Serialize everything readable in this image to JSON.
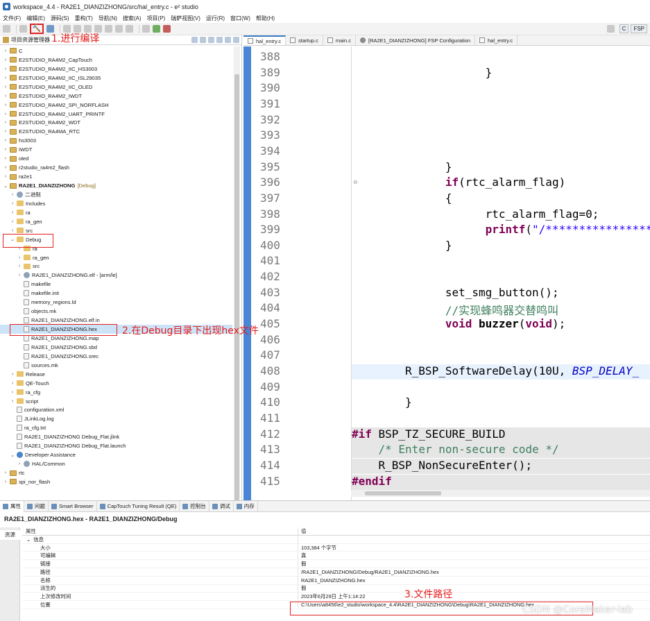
{
  "window": {
    "title": "workspace_4.4 - RA2E1_DIANZIZHONG/src/hal_entry.c - e² studio"
  },
  "menu": [
    "文件(F)",
    "编辑(E)",
    "源码(S)",
    "重构(T)",
    "导航(N)",
    "搜索(A)",
    "项目(P)",
    "瑞萨视图(V)",
    "运行(R)",
    "窗口(W)",
    "帮助(H)"
  ],
  "toolbar": {
    "perspective_c": "C",
    "perspective_fsp": "FSP"
  },
  "annotations": {
    "build": "1.进行编译",
    "hex": "2.在Debug目录下出现hex文件",
    "path": "3.文件路径"
  },
  "explorer": {
    "title": "项目资源管理器",
    "items": [
      {
        "label": "C",
        "depth": 0,
        "chev": "›",
        "icon": "project"
      },
      {
        "label": "E2STUDIO_RA4M2_CapTouch",
        "depth": 0,
        "chev": "›",
        "icon": "project"
      },
      {
        "label": "E2STUDIO_RA4M2_IIC_HS3003",
        "depth": 0,
        "chev": "›",
        "icon": "project"
      },
      {
        "label": "E2STUDIO_RA4M2_IIC_ISL29035",
        "depth": 0,
        "chev": "›",
        "icon": "project"
      },
      {
        "label": "E2STUDIO_RA4M2_IIC_OLED",
        "depth": 0,
        "chev": "›",
        "icon": "project"
      },
      {
        "label": "E2STUDIO_RA4M2_IWDT",
        "depth": 0,
        "chev": "›",
        "icon": "project"
      },
      {
        "label": "E2STUDIO_RA4M2_SPI_NORFLASH",
        "depth": 0,
        "chev": "›",
        "icon": "project"
      },
      {
        "label": "E2STUDIO_RA4M2_UART_PRINTF",
        "depth": 0,
        "chev": "›",
        "icon": "project"
      },
      {
        "label": "E2STUDIO_RA4M2_WDT",
        "depth": 0,
        "chev": "›",
        "icon": "project"
      },
      {
        "label": "E2STUDIO_RA4MA_RTC",
        "depth": 0,
        "chev": "›",
        "icon": "project"
      },
      {
        "label": "hs3003",
        "depth": 0,
        "chev": "›",
        "icon": "project"
      },
      {
        "label": "IWDT",
        "depth": 0,
        "chev": "›",
        "icon": "project"
      },
      {
        "label": "oled",
        "depth": 0,
        "chev": "›",
        "icon": "project"
      },
      {
        "label": "r2studio_ra4m2_flash",
        "depth": 0,
        "chev": "›",
        "icon": "project"
      },
      {
        "label": "ra2e1",
        "depth": 0,
        "chev": "›",
        "icon": "project"
      },
      {
        "label": "RA2E1_DIANZIZHONG",
        "suffix": "[Debug]",
        "depth": 0,
        "chev": "⌄",
        "icon": "project",
        "bold": true
      },
      {
        "label": "二进制",
        "depth": 1,
        "chev": "›",
        "icon": "gear"
      },
      {
        "label": "Includes",
        "depth": 1,
        "chev": "›",
        "icon": "folder"
      },
      {
        "label": "ra",
        "depth": 1,
        "chev": "›",
        "icon": "folder"
      },
      {
        "label": "ra_gen",
        "depth": 1,
        "chev": "›",
        "icon": "folder"
      },
      {
        "label": "src",
        "depth": 1,
        "chev": "›",
        "icon": "folder"
      },
      {
        "label": "Debug",
        "depth": 1,
        "chev": "⌄",
        "icon": "folder"
      },
      {
        "label": "ra",
        "depth": 2,
        "chev": "›",
        "icon": "folder"
      },
      {
        "label": "ra_gen",
        "depth": 2,
        "chev": "›",
        "icon": "folder"
      },
      {
        "label": "src",
        "depth": 2,
        "chev": "›",
        "icon": "folder"
      },
      {
        "label": "RA2E1_DIANZIZHONG.elf - [arm/le]",
        "depth": 2,
        "chev": "›",
        "icon": "gear"
      },
      {
        "label": "makefile",
        "depth": 2,
        "chev": "",
        "icon": "file"
      },
      {
        "label": "makefile.init",
        "depth": 2,
        "chev": "",
        "icon": "file"
      },
      {
        "label": "memory_regions.ld",
        "depth": 2,
        "chev": "",
        "icon": "file"
      },
      {
        "label": "objects.mk",
        "depth": 2,
        "chev": "",
        "icon": "file"
      },
      {
        "label": "RA2E1_DIANZIZHONG.elf.in",
        "depth": 2,
        "chev": "",
        "icon": "file"
      },
      {
        "label": "RA2E1_DIANZIZHONG.hex",
        "depth": 2,
        "chev": "",
        "icon": "file",
        "selected": true
      },
      {
        "label": "RA2E1_DIANZIZHONG.map",
        "depth": 2,
        "chev": "",
        "icon": "file"
      },
      {
        "label": "RA2E1_DIANZIZHONG.sbd",
        "depth": 2,
        "chev": "",
        "icon": "file"
      },
      {
        "label": "RA2E1_DIANZIZHONG.srec",
        "depth": 2,
        "chev": "",
        "icon": "file"
      },
      {
        "label": "sources.mk",
        "depth": 2,
        "chev": "",
        "icon": "file"
      },
      {
        "label": "Release",
        "depth": 1,
        "chev": "›",
        "icon": "folder"
      },
      {
        "label": "QE-Touch",
        "depth": 1,
        "chev": "›",
        "icon": "folder"
      },
      {
        "label": "ra_cfg",
        "depth": 1,
        "chev": "›",
        "icon": "folder"
      },
      {
        "label": "script",
        "depth": 1,
        "chev": "›",
        "icon": "folder"
      },
      {
        "label": "configuration.xml",
        "depth": 1,
        "chev": "",
        "icon": "file"
      },
      {
        "label": "JLinkLog.log",
        "depth": 1,
        "chev": "",
        "icon": "file"
      },
      {
        "label": "ra_cfg.txt",
        "depth": 1,
        "chev": "",
        "icon": "file"
      },
      {
        "label": "RA2E1_DIANZIZHONG Debug_Flat.jlink",
        "depth": 1,
        "chev": "",
        "icon": "file"
      },
      {
        "label": "RA2E1_DIANZIZHONG Debug_Flat.launch",
        "depth": 1,
        "chev": "",
        "icon": "file"
      },
      {
        "label": "Developer Assistance",
        "depth": 1,
        "chev": "⌄",
        "icon": "help"
      },
      {
        "label": "HAL/Common",
        "depth": 2,
        "chev": "›",
        "icon": "gear"
      },
      {
        "label": "rtc",
        "depth": 0,
        "chev": "›",
        "icon": "project"
      },
      {
        "label": "spi_nor_flash",
        "depth": 0,
        "chev": "›",
        "icon": "project"
      }
    ]
  },
  "editor": {
    "tabs": [
      {
        "label": "hal_entry.c",
        "active": true,
        "icon": "file"
      },
      {
        "label": "startup.c",
        "active": false,
        "icon": "file"
      },
      {
        "label": "main.c",
        "active": false,
        "icon": "file"
      },
      {
        "label": "[RA2E1_DIANZIZHONG] FSP Configuration",
        "active": false,
        "icon": "gear"
      },
      {
        "label": "hal_entry.c",
        "active": false,
        "icon": "file"
      }
    ],
    "lines": [
      {
        "num": "388",
        "indent": 0,
        "tokens": []
      },
      {
        "num": "389",
        "indent": 20,
        "tokens": [
          {
            "t": "}",
            "c": ""
          }
        ]
      },
      {
        "num": "390",
        "indent": 0,
        "tokens": []
      },
      {
        "num": "391",
        "indent": 0,
        "tokens": []
      },
      {
        "num": "392",
        "indent": 0,
        "tokens": []
      },
      {
        "num": "393",
        "indent": 0,
        "tokens": []
      },
      {
        "num": "394",
        "indent": 0,
        "tokens": []
      },
      {
        "num": "395",
        "indent": 14,
        "tokens": [
          {
            "t": "}",
            "c": ""
          }
        ]
      },
      {
        "num": "396",
        "indent": 14,
        "fold": true,
        "tokens": [
          {
            "t": "if",
            "c": "kw"
          },
          {
            "t": "(rtc_alarm_flag)",
            "c": ""
          }
        ]
      },
      {
        "num": "397",
        "indent": 14,
        "tokens": [
          {
            "t": "{",
            "c": ""
          }
        ]
      },
      {
        "num": "398",
        "indent": 20,
        "tokens": [
          {
            "t": "rtc_alarm_flag=0;",
            "c": ""
          }
        ]
      },
      {
        "num": "399",
        "indent": 20,
        "tokens": [
          {
            "t": "printf",
            "c": "kw"
          },
          {
            "t": "(",
            "c": ""
          },
          {
            "t": "\"/*****************",
            "c": "str"
          }
        ]
      },
      {
        "num": "400",
        "indent": 14,
        "tokens": [
          {
            "t": "}",
            "c": ""
          }
        ]
      },
      {
        "num": "401",
        "indent": 0,
        "tokens": []
      },
      {
        "num": "402",
        "indent": 0,
        "tokens": []
      },
      {
        "num": "403",
        "indent": 14,
        "tokens": [
          {
            "t": "set_smg_button();",
            "c": ""
          }
        ]
      },
      {
        "num": "404",
        "indent": 14,
        "tokens": [
          {
            "t": "//实现蜂鸣器交替鸣叫",
            "c": "cm"
          }
        ]
      },
      {
        "num": "405",
        "indent": 14,
        "tokens": [
          {
            "t": "void",
            "c": "kw"
          },
          {
            "t": " ",
            "c": ""
          },
          {
            "t": "buzzer",
            "c": "fn-bold"
          },
          {
            "t": "(",
            "c": ""
          },
          {
            "t": "void",
            "c": "kw"
          },
          {
            "t": ");",
            "c": ""
          }
        ]
      },
      {
        "num": "406",
        "indent": 0,
        "tokens": []
      },
      {
        "num": "407",
        "indent": 0,
        "tokens": []
      },
      {
        "num": "408",
        "indent": 8,
        "hl": true,
        "tokens": [
          {
            "t": "R_BSP_SoftwareDelay(10U, ",
            "c": ""
          },
          {
            "t": "BSP_DELAY_",
            "c": "macro"
          }
        ]
      },
      {
        "num": "409",
        "indent": 0,
        "tokens": []
      },
      {
        "num": "410",
        "indent": 8,
        "tokens": [
          {
            "t": "}",
            "c": ""
          }
        ]
      },
      {
        "num": "411",
        "indent": 0,
        "tokens": []
      },
      {
        "num": "412",
        "indent": 0,
        "gray": true,
        "fold": true,
        "tokens": [
          {
            "t": "#if",
            "c": "kw"
          },
          {
            "t": " BSP_TZ_SECURE_BUILD",
            "c": ""
          }
        ]
      },
      {
        "num": "413",
        "indent": 4,
        "gray": true,
        "tokens": [
          {
            "t": "/* Enter non-secure code */",
            "c": "cm"
          }
        ]
      },
      {
        "num": "414",
        "indent": 4,
        "gray": true,
        "tokens": [
          {
            "t": "R_BSP_NonSecureEnter();",
            "c": ""
          }
        ]
      },
      {
        "num": "415",
        "indent": 0,
        "gray": true,
        "tokens": [
          {
            "t": "#endif",
            "c": "kw"
          }
        ]
      }
    ]
  },
  "bottom": {
    "tabs": [
      {
        "label": "属性",
        "active": true
      },
      {
        "label": "问题",
        "active": false
      },
      {
        "label": "Smart Browser",
        "active": false
      },
      {
        "label": "CapTouch Tuning Result (QE)",
        "active": false
      },
      {
        "label": "控制台",
        "active": false
      },
      {
        "label": "调试",
        "active": false
      },
      {
        "label": "内存",
        "active": false
      }
    ],
    "title": "RA2E1_DIANZIZHONG.hex - RA2E1_DIANZIZHONG/Debug",
    "side_tab": "资源",
    "header": {
      "key": "属性",
      "value": "值"
    },
    "group": "信息",
    "rows": [
      {
        "key": "大小",
        "value": "103,384 个字节"
      },
      {
        "key": "可编辑",
        "value": "真"
      },
      {
        "key": "链接",
        "value": "假"
      },
      {
        "key": "路径",
        "value": "/RA2E1_DIANZIZHONG/Debug/RA2E1_DIANZIZHONG.hex"
      },
      {
        "key": "名称",
        "value": "RA2E1_DIANZIZHONG.hex"
      },
      {
        "key": "派生的",
        "value": "假"
      },
      {
        "key": "上次修改时间",
        "value": "2023年6月29日 上午1:14:22"
      },
      {
        "key": "位置",
        "value": "C:\\Users\\a8456\\e2_studio\\workspace_4.4\\RA2E1_DIANZIZHONG\\Debug\\RA2E1_DIANZIZHONG.hex"
      }
    ]
  },
  "watermark": "CSDN @CoreMaker-lab"
}
